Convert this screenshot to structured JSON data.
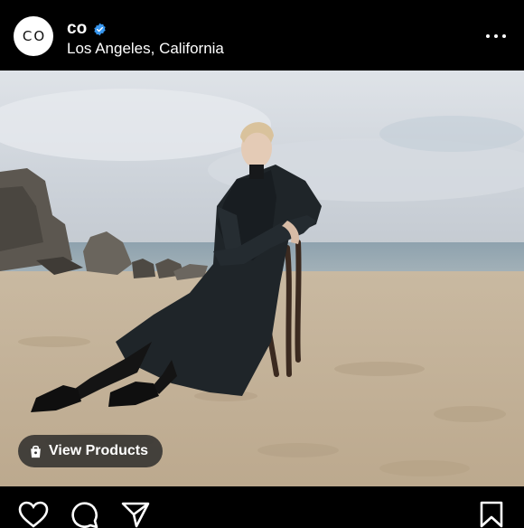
{
  "post": {
    "username": "co",
    "avatar_text": "CO",
    "location": "Los Angeles, California",
    "verified": true,
    "more_options_icon": "more-horizontal-icon"
  },
  "shopping": {
    "view_products_label": "View Products",
    "icon": "shopping-bag-icon"
  },
  "actions": {
    "like_icon": "heart-icon",
    "comment_icon": "comment-icon",
    "share_icon": "send-icon",
    "save_icon": "bookmark-icon"
  },
  "colors": {
    "background": "#000000",
    "verified_badge": "#3897F0",
    "text": "#FFFFFF"
  }
}
